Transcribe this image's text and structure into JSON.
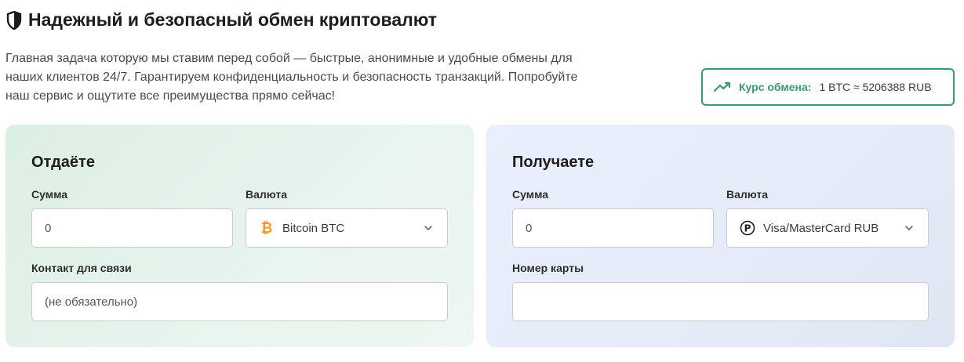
{
  "header": {
    "title": "Надежный и безопасный обмен криптовалют",
    "description": "Главная задача которую мы ставим перед собой — быстрые, анонимные и удобные обмены для наших клиентов 24/7. Гарантируем конфиденциальность и безопасность транзакций. Попробуйте наш сервис и ощутите все преимущества прямо сейчас!"
  },
  "rate": {
    "label": "Курс обмена:",
    "value": "1 BTC ≈ 5206388 RUB",
    "accent_color": "#3a9b6a"
  },
  "give": {
    "heading": "Отдаёте",
    "amount_label": "Сумма",
    "amount_value": "0",
    "currency_label": "Валюта",
    "currency_value": "Bitcoin BTC",
    "currency_icon": "bitcoin-icon",
    "contact_label": "Контакт для связи",
    "contact_placeholder": "(не обязательно)"
  },
  "get": {
    "heading": "Получаете",
    "amount_label": "Сумма",
    "amount_value": "0",
    "currency_label": "Валюта",
    "currency_value": "Visa/MasterCard RUB",
    "currency_icon": "ruble-icon",
    "card_label": "Номер карты",
    "card_placeholder": ""
  }
}
